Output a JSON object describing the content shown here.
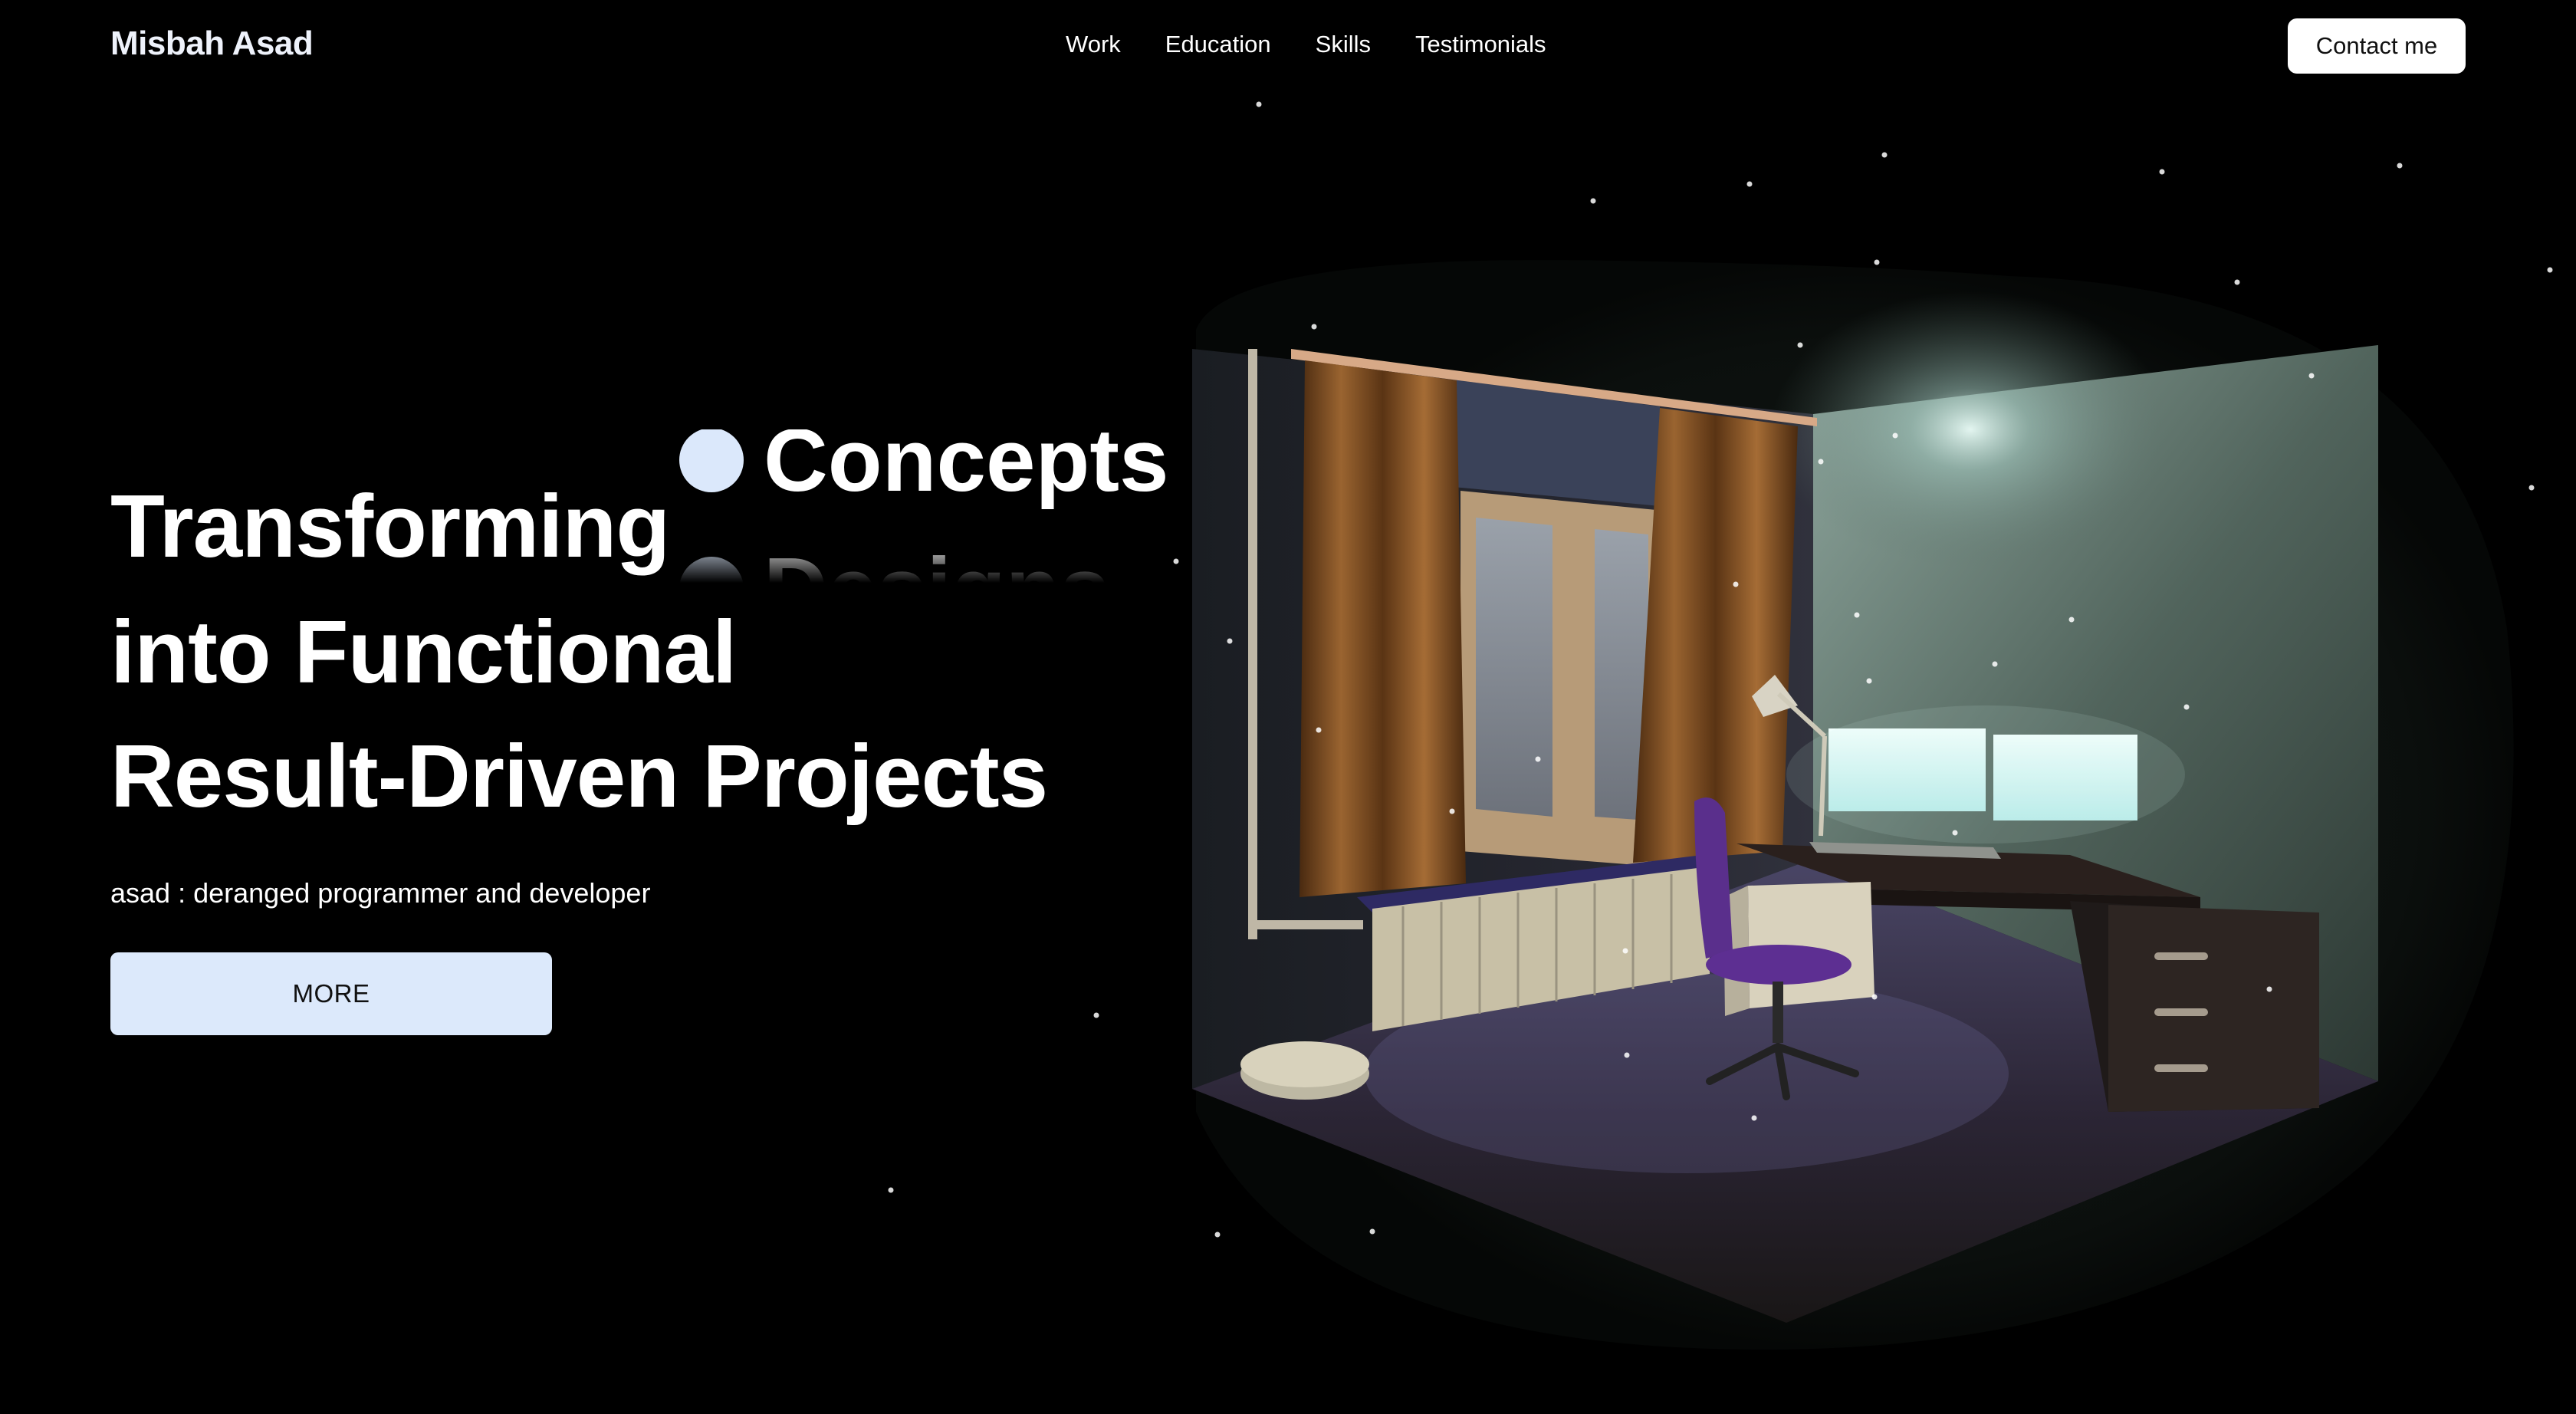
{
  "navbar": {
    "brand": "Misbah Asad",
    "links": [
      "Work",
      "Education",
      "Skills",
      "Testimonials"
    ],
    "contact_label": "Contact me"
  },
  "hero": {
    "headline_lines": [
      "Transforming",
      "into Functional",
      "Result-Driven Projects"
    ],
    "rotating_words": [
      "Concepts",
      "Designs"
    ],
    "tagline": "asad : deranged programmer and developer",
    "cta_label": "MORE"
  },
  "scene": {
    "subject": "isometric-bedroom-desk-setup",
    "accent_glow": "#cfeee8",
    "chair_color": "#5a2f8c",
    "curtain_color": "#8a5a2a"
  }
}
